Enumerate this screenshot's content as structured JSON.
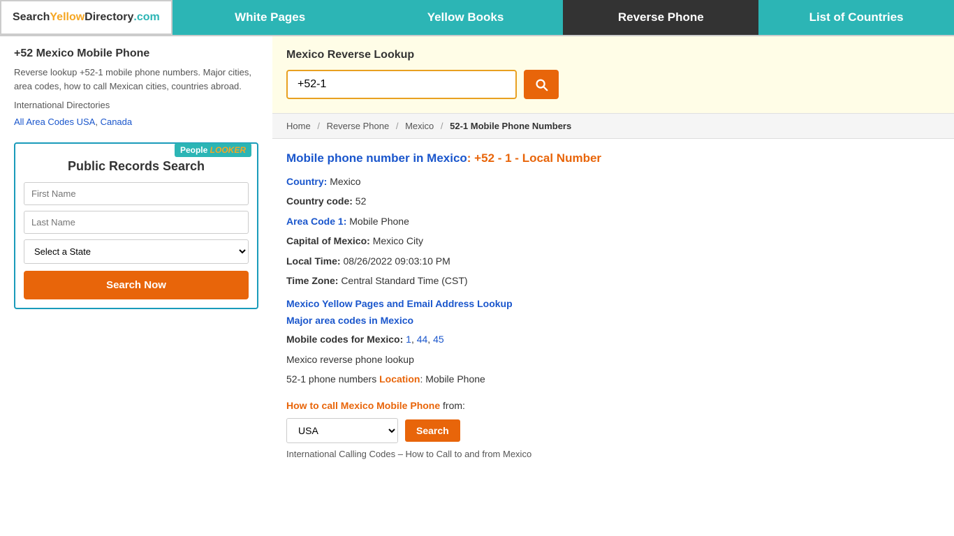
{
  "nav": {
    "logo": {
      "search": "Search",
      "yellow": "Yellow",
      "directory": "Directory",
      "com": ".com"
    },
    "items": [
      {
        "label": "White Pages",
        "class": "white-pages"
      },
      {
        "label": "Yellow Books",
        "class": "yellow-books"
      },
      {
        "label": "Reverse Phone",
        "class": "reverse-phone"
      },
      {
        "label": "List of Countries",
        "class": "list-countries"
      }
    ]
  },
  "sidebar": {
    "heading": "+52 Mexico Mobile Phone",
    "description": "Reverse lookup +52-1 mobile phone numbers. Major cities, area codes, how to call Mexican cities, countries abroad.",
    "int_dir_label": "International Directories",
    "links": [
      {
        "text": "All Area Codes USA",
        "url": "#"
      },
      {
        "separator": ", "
      },
      {
        "text": "Canada",
        "url": "#"
      }
    ],
    "people_looker": {
      "badge_people": "People",
      "badge_looker": "LOOKER",
      "title": "Public Records Search",
      "first_name_placeholder": "First Name",
      "last_name_placeholder": "Last Name",
      "state_placeholder": "Select a State",
      "search_btn": "Search Now"
    }
  },
  "search_box": {
    "title": "Mexico Reverse Lookup",
    "phone_value": "+52-1",
    "phone_placeholder": "+52-1"
  },
  "breadcrumb": {
    "home": "Home",
    "reverse_phone": "Reverse Phone",
    "mexico": "Mexico",
    "current": "52-1 Mobile Phone Numbers"
  },
  "info": {
    "title_prefix": "Mobile phone number in Mexico",
    "title_link": "Mobile phone number in Mexico",
    "title_suffix": ": +52 - 1 - Local Number",
    "country_label": "Country:",
    "country_value": "Mexico",
    "country_code_label": "Country code:",
    "country_code_value": "52",
    "area_code_label": "Area Code 1:",
    "area_code_link": "Area Code 1:",
    "area_code_value": "Mobile Phone",
    "capital_label": "Capital of Mexico:",
    "capital_value": "Mexico City",
    "local_time_label": "Local Time:",
    "local_time_value": "08/26/2022 09:03:10 PM",
    "timezone_label": "Time Zone:",
    "timezone_value": "Central Standard Time (CST)",
    "yellow_pages_link": "Mexico Yellow Pages and Email Address Lookup",
    "major_area_codes_link": "Major area codes in Mexico",
    "mobile_codes_label": "Mobile codes for Mexico:",
    "mobile_codes": [
      "1",
      "44",
      "45"
    ],
    "reverse_phone_label": "Mexico reverse phone lookup",
    "location_prefix": "52-1 phone numbers ",
    "location_link": "Location",
    "location_suffix": ": Mobile Phone",
    "how_to_call_title_prefix": "How to call Mexico Mobile Phone",
    "how_to_call_title_suffix": " from:",
    "default_country": "USA",
    "search_btn": "Search",
    "int_calling_note": "International Calling Codes – How to Call to and from Mexico"
  }
}
